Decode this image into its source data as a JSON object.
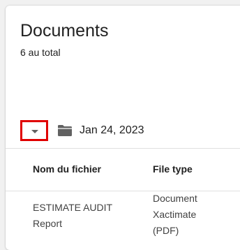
{
  "header": {
    "title": "Documents",
    "count_text": "6 au total"
  },
  "group": {
    "toggle_icon": "caret-down-icon",
    "folder_icon": "folder-icon",
    "date_label": "Jan 24, 2023"
  },
  "table": {
    "columns": [
      "Nom du fichier",
      "File type"
    ],
    "rows": [
      {
        "name_lines": [
          "ESTIMATE AUDIT",
          "Report"
        ],
        "type_lines": [
          "Document",
          "Xactimate",
          "(PDF)"
        ]
      }
    ]
  },
  "colors": {
    "highlight_border": "#e00000",
    "icon_gray": "#616161"
  }
}
